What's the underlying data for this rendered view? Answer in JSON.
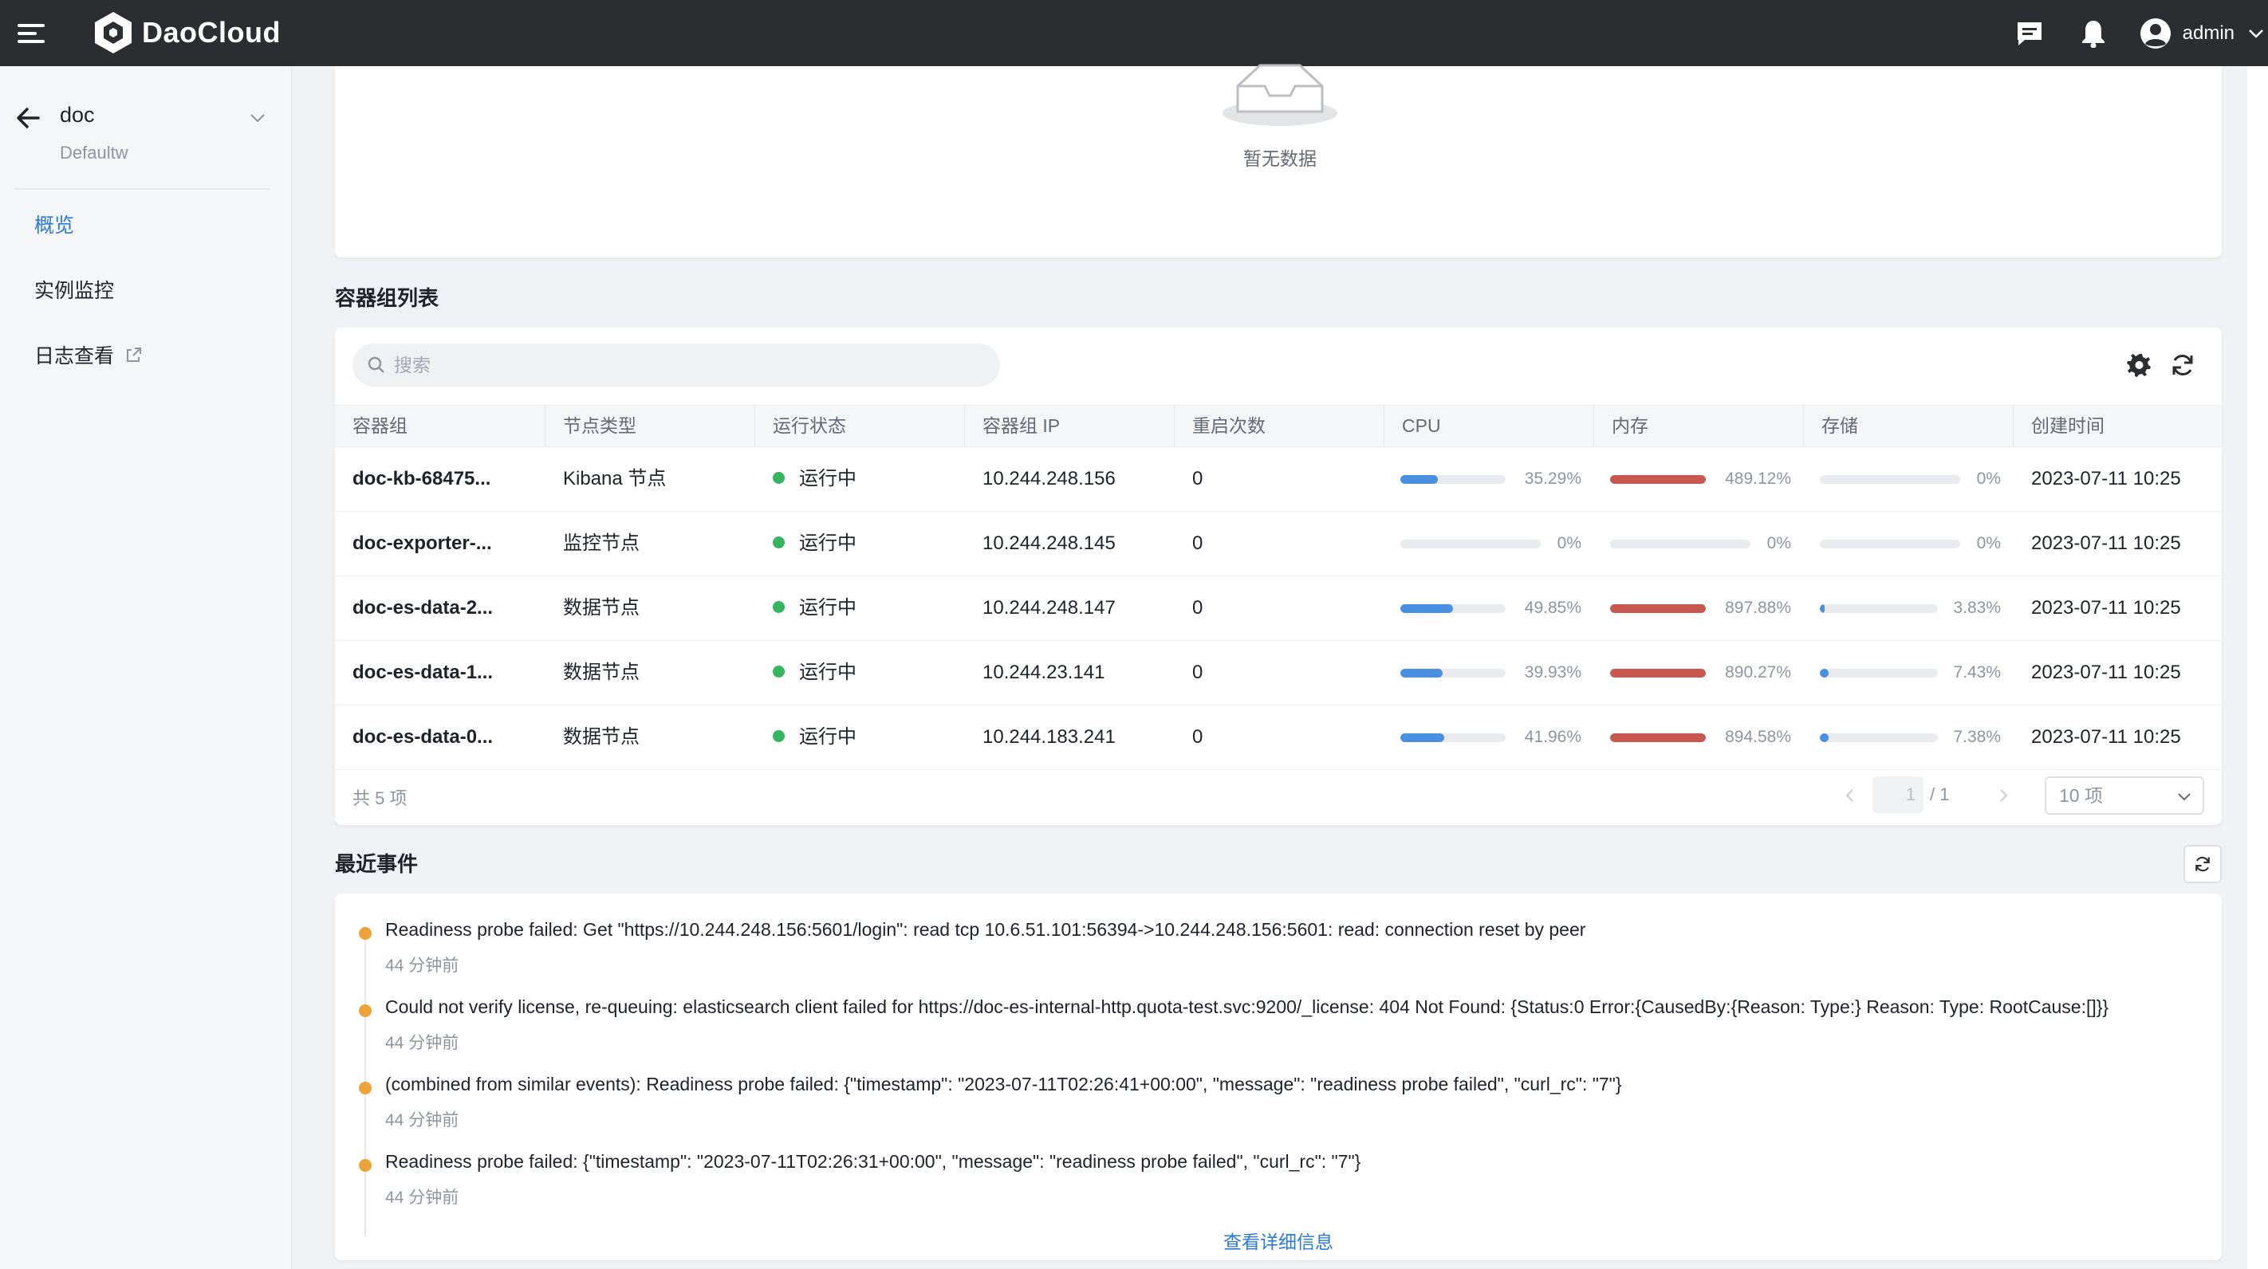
{
  "header": {
    "brand": "DaoCloud",
    "user": "admin"
  },
  "sidebar": {
    "title": "doc",
    "subtitle": "Defaultw",
    "items": [
      {
        "label": "概览",
        "active": true
      },
      {
        "label": "实例监控",
        "active": false
      },
      {
        "label": "日志查看",
        "active": false,
        "external": true
      }
    ]
  },
  "empty": {
    "text": "暂无数据"
  },
  "pods": {
    "title": "容器组列表",
    "search_placeholder": "搜索",
    "columns": [
      "容器组",
      "节点类型",
      "运行状态",
      "容器组 IP",
      "重启次数",
      "CPU",
      "内存",
      "存储",
      "创建时间"
    ],
    "rows": [
      {
        "name": "doc-kb-68475...",
        "type": "Kibana 节点",
        "status": "运行中",
        "ip": "10.244.248.156",
        "restarts": "0",
        "cpu": "35.29%",
        "cpu_v": 0.353,
        "mem": "489.12%",
        "mem_v": 1.0,
        "sto": "0%",
        "sto_v": 0,
        "created": "2023-07-11 10:25"
      },
      {
        "name": "doc-exporter-...",
        "type": "监控节点",
        "status": "运行中",
        "ip": "10.244.248.145",
        "restarts": "0",
        "cpu": "0%",
        "cpu_v": 0,
        "mem": "0%",
        "mem_v": 0,
        "sto": "0%",
        "sto_v": 0,
        "created": "2023-07-11 10:25"
      },
      {
        "name": "doc-es-data-2...",
        "type": "数据节点",
        "status": "运行中",
        "ip": "10.244.248.147",
        "restarts": "0",
        "cpu": "49.85%",
        "cpu_v": 0.4985,
        "mem": "897.88%",
        "mem_v": 1.0,
        "sto": "3.83%",
        "sto_v": 0.0383,
        "created": "2023-07-11 10:25"
      },
      {
        "name": "doc-es-data-1...",
        "type": "数据节点",
        "status": "运行中",
        "ip": "10.244.23.141",
        "restarts": "0",
        "cpu": "39.93%",
        "cpu_v": 0.3993,
        "mem": "890.27%",
        "mem_v": 1.0,
        "sto": "7.43%",
        "sto_v": 0.0743,
        "created": "2023-07-11 10:25"
      },
      {
        "name": "doc-es-data-0...",
        "type": "数据节点",
        "status": "运行中",
        "ip": "10.244.183.241",
        "restarts": "0",
        "cpu": "41.96%",
        "cpu_v": 0.4196,
        "mem": "894.58%",
        "mem_v": 1.0,
        "sto": "7.38%",
        "sto_v": 0.0738,
        "created": "2023-07-11 10:25"
      }
    ],
    "total": "共 5 项",
    "page_current": "1",
    "page_total": "/ 1",
    "page_size": "10 项"
  },
  "events": {
    "title": "最近事件",
    "items": [
      {
        "message": "Readiness probe failed: Get \"https://10.244.248.156:5601/login\": read tcp 10.6.51.101:56394->10.244.248.156:5601: read: connection reset by peer",
        "time": "44 分钟前"
      },
      {
        "message": "Could not verify license, re-queuing: elasticsearch client failed for https://doc-es-internal-http.quota-test.svc:9200/_license: 404 Not Found: {Status:0 Error:{CausedBy:{Reason: Type:} Reason: Type: RootCause:[]}}",
        "time": "44 分钟前"
      },
      {
        "message": "(combined from similar events): Readiness probe failed: {\"timestamp\": \"2023-07-11T02:26:41+00:00\", \"message\": \"readiness probe failed\", \"curl_rc\": \"7\"}",
        "time": "44 分钟前"
      },
      {
        "message": "Readiness probe failed: {\"timestamp\": \"2023-07-11T02:26:31+00:00\", \"message\": \"readiness probe failed\", \"curl_rc\": \"7\"}",
        "time": "44 分钟前"
      }
    ],
    "more": "查看详细信息"
  },
  "colors": {
    "cpu": "#4a90e2",
    "mem": "#c8574f",
    "sto": "#4a90e2",
    "running": "#34b55e",
    "event": "#eda33a",
    "link": "#2a7bd8"
  }
}
